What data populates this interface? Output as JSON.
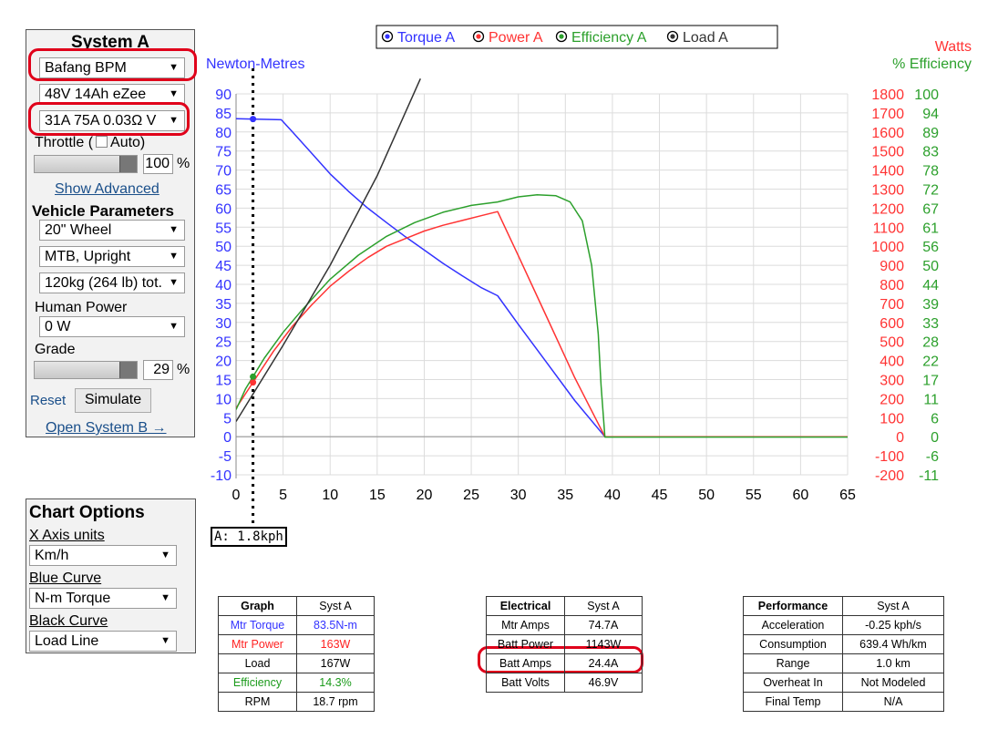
{
  "system": {
    "title": "System A",
    "motor": "Bafang BPM",
    "battery": "48V 14Ah eZee",
    "controller": "31A 75A 0.03Ω V",
    "throttle_label": "Throttle (",
    "auto_label": "Auto)",
    "throttle_value": "100",
    "percent": "%",
    "show_advanced": "Show Advanced",
    "vehicle_params_title": "Vehicle Parameters",
    "wheel": "20\"  Wheel",
    "bike_type": "MTB, Upright",
    "weight": "120kg (264 lb) tot.",
    "human_power_label": "Human Power",
    "human_power": "0 W",
    "grade_label": "Grade",
    "grade_value": "29",
    "reset": "Reset",
    "simulate": "Simulate",
    "open_system_b": "Open System B →"
  },
  "chart_options": {
    "title": "Chart Options",
    "x_axis_label": "X Axis units",
    "x_axis_value": "Km/h",
    "blue_curve_label": "Blue Curve",
    "blue_curve_value": "N-m Torque",
    "black_curve_label": "Black Curve",
    "black_curve_value": "Load Line"
  },
  "colors": {
    "torque": "#3333ff",
    "power": "#ff3333",
    "efficiency": "#2ca02c",
    "load": "#333333",
    "highlight": "#e0001a"
  },
  "cursor_label": "A: 1.8kph",
  "chart_data": {
    "type": "line",
    "legend": [
      "Torque A",
      "Power A",
      "Efficiency A",
      "Load A"
    ],
    "legend_position": "top",
    "ylabel_left": "Newton-Metres",
    "ylabel_right_1": "Watts",
    "ylabel_right_2": "% Efficiency",
    "xlim": [
      0,
      65
    ],
    "ylim_left": [
      -10,
      90
    ],
    "ylim_watts": [
      -200,
      1800
    ],
    "ylim_eff": [
      -11,
      100
    ],
    "x_ticks": [
      0,
      5,
      10,
      15,
      20,
      25,
      30,
      35,
      40,
      45,
      50,
      55,
      60,
      65
    ],
    "y_ticks_left": [
      90,
      85,
      80,
      75,
      70,
      65,
      60,
      55,
      50,
      45,
      40,
      35,
      30,
      25,
      20,
      15,
      10,
      5,
      0,
      -5,
      -10
    ],
    "y_ticks_watts": [
      1800,
      1700,
      1600,
      1500,
      1400,
      1300,
      1200,
      1100,
      1000,
      900,
      800,
      700,
      600,
      500,
      400,
      300,
      200,
      100,
      0,
      -100,
      -200
    ],
    "y_ticks_eff": [
      100,
      94,
      89,
      83,
      78,
      72,
      67,
      61,
      56,
      50,
      44,
      39,
      33,
      28,
      22,
      17,
      11,
      6,
      0,
      -6,
      -11
    ],
    "grid": true,
    "cursor_x": 1.8,
    "series": [
      {
        "name": "Torque A",
        "axis": "left",
        "x": [
          0,
          4.8,
          6,
          8,
          10,
          12,
          14,
          16,
          18,
          20,
          22,
          24,
          26,
          27.8,
          30,
          33,
          36,
          39.2,
          65
        ],
        "values": [
          83.5,
          83.2,
          80,
          74.5,
          69,
          64.3,
          60,
          56.2,
          52.5,
          49,
          45.5,
          42.3,
          39.2,
          37,
          29.5,
          19.5,
          9.5,
          0,
          0
        ]
      },
      {
        "name": "Power A",
        "axis": "watts",
        "x": [
          0,
          2,
          4,
          6,
          8,
          10,
          12,
          14,
          16,
          18,
          20,
          22,
          24,
          26,
          27.8,
          30,
          33,
          36,
          39.2,
          65
        ],
        "values": [
          150,
          300,
          450,
          580,
          690,
          790,
          870,
          940,
          1000,
          1040,
          1080,
          1110,
          1135,
          1160,
          1182,
          950,
          630,
          310,
          0,
          0
        ]
      },
      {
        "name": "Efficiency A",
        "axis": "eff",
        "x": [
          0,
          1,
          3,
          5,
          7,
          10,
          13,
          16,
          19,
          22,
          25,
          27.8,
          30,
          32,
          34,
          35.5,
          36.8,
          37.8,
          38.5,
          38.8,
          39.2,
          65
        ],
        "values": [
          8,
          14,
          23,
          30.5,
          37,
          46,
          53,
          58.5,
          62.5,
          65.5,
          67.5,
          68.5,
          70,
          70.6,
          70.3,
          68.5,
          63,
          50,
          30,
          15,
          0,
          0
        ]
      },
      {
        "name": "Load A",
        "axis": "watts",
        "x": [
          0,
          5,
          10,
          15,
          19.6
        ],
        "values": [
          80,
          480,
          900,
          1370,
          1880
        ]
      }
    ]
  },
  "tables": {
    "graph": {
      "headers": [
        "Graph",
        "Syst A"
      ],
      "rows": [
        [
          "Mtr Torque",
          "83.5N-m"
        ],
        [
          "Mtr Power",
          "163W"
        ],
        [
          "Load",
          "167W"
        ],
        [
          "Efficiency",
          "14.3%"
        ],
        [
          "RPM",
          "18.7 rpm"
        ]
      ]
    },
    "electrical": {
      "headers": [
        "Electrical",
        "Syst A"
      ],
      "rows": [
        [
          "Mtr Amps",
          "74.7A"
        ],
        [
          "Batt Power",
          "1143W"
        ],
        [
          "Batt Amps",
          "24.4A"
        ],
        [
          "Batt Volts",
          "46.9V"
        ]
      ]
    },
    "performance": {
      "headers": [
        "Performance",
        "Syst A"
      ],
      "rows": [
        [
          "Acceleration",
          "-0.25 kph/s"
        ],
        [
          "Consumption",
          "639.4 Wh/km"
        ],
        [
          "Range",
          "1.0 km"
        ],
        [
          "Overheat In",
          "Not Modeled"
        ],
        [
          "Final Temp",
          "N/A"
        ]
      ]
    }
  }
}
